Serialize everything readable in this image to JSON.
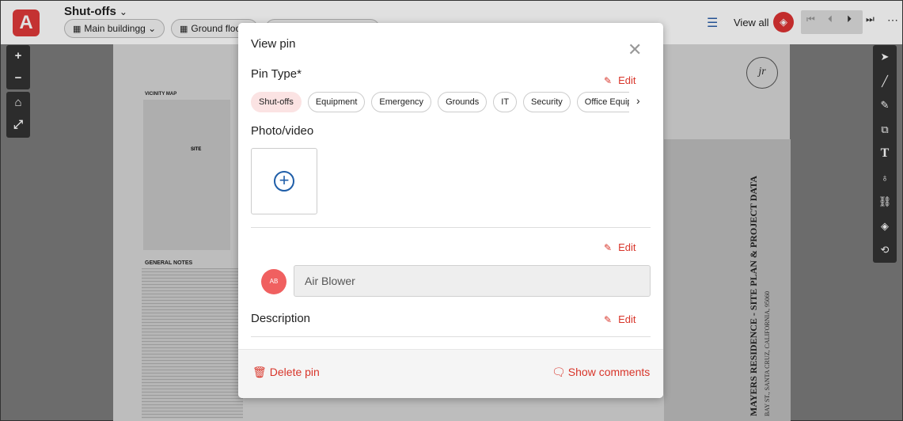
{
  "app": {
    "logo_letter": "A",
    "project_title": "Shut-offs",
    "project_chevron": "⌄",
    "breadcrumbs": [
      {
        "icon": "building-icon",
        "label": "Main buildingg"
      },
      {
        "icon": "floor-icon",
        "label": "Ground floo"
      }
    ],
    "view_all_label": "View all",
    "accent": "#d8352a"
  },
  "drawing": {
    "stamp_text": "jr",
    "title_block_main": "MAYERS RESIDENCE - SITE PLAN & PROJECT DATA",
    "title_block_sub": "BAY ST., SANTA CRUZ, CALIFORNIA, 95060",
    "vicinity_map_label": "VICINITY MAP",
    "site_label": "SITE",
    "general_notes_label": "GENERAL NOTES"
  },
  "modal": {
    "title": "View pin",
    "pin_type_label": "Pin Type*",
    "edit_label": "Edit",
    "pin_types": [
      {
        "label": "Shut-offs",
        "selected": true
      },
      {
        "label": "Equipment",
        "selected": false
      },
      {
        "label": "Emergency",
        "selected": false
      },
      {
        "label": "Grounds",
        "selected": false
      },
      {
        "label": "IT",
        "selected": false
      },
      {
        "label": "Security",
        "selected": false
      },
      {
        "label": "Office Equipm",
        "selected": false
      }
    ],
    "photo_label": "Photo/video",
    "assignee_initials": "AB",
    "assignee_name": "Air Blower",
    "description_label": "Description",
    "delete_label": "Delete pin",
    "comments_label": "Show comments"
  }
}
